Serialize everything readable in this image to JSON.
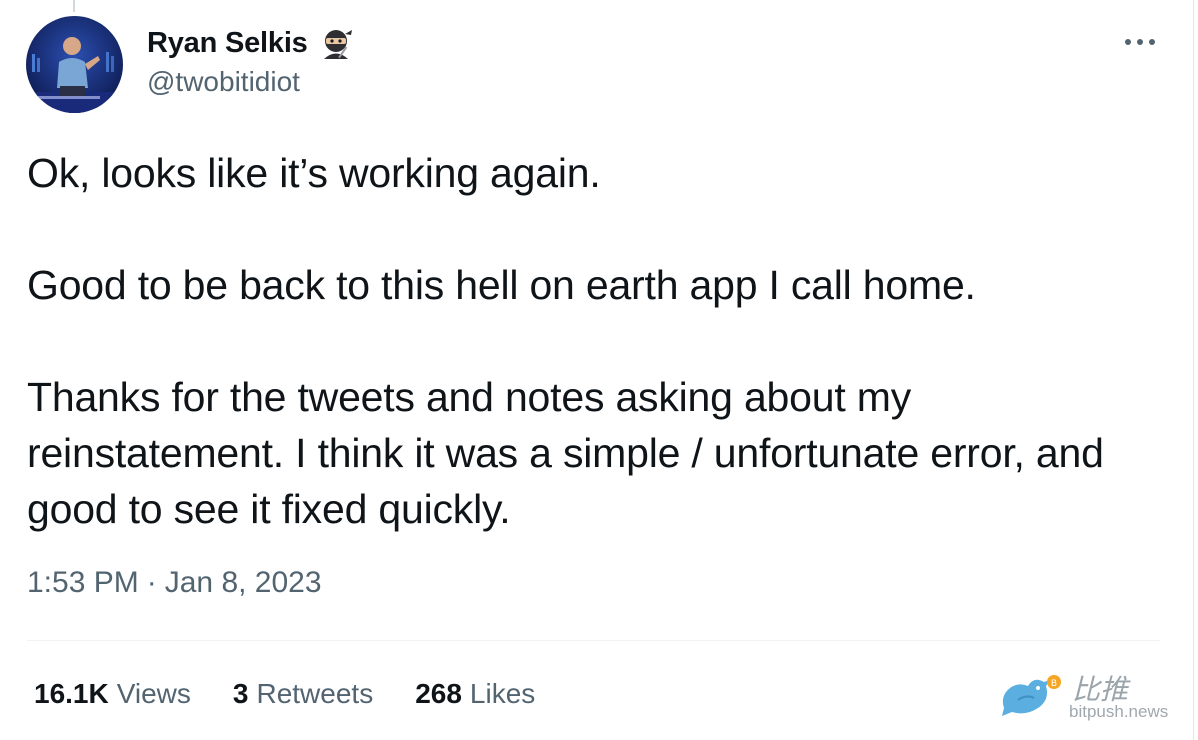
{
  "author": {
    "display_name": "Ryan Selkis",
    "handle": "@twobitidiot",
    "name_emoji_icon": "ninja-icon"
  },
  "menu": {
    "more_icon": "more-horizontal-icon"
  },
  "tweet": {
    "paragraphs": [
      "Ok, looks like it’s working again.",
      "Good to be back to this hell on earth app I call home.",
      "Thanks for the tweets and notes asking about my reinstatement. I think it was a simple / unfortunate error, and good to see it fixed quickly."
    ]
  },
  "meta": {
    "time": "1:53 PM",
    "separator": "·",
    "date": "Jan 8, 2023"
  },
  "stats": {
    "views_count": "16.1K",
    "views_label": "Views",
    "retweets_count": "3",
    "retweets_label": "Retweets",
    "likes_count": "268",
    "likes_label": "Likes"
  },
  "watermark": {
    "chinese_text": "比推",
    "domain": "bitpush.news"
  },
  "colors": {
    "text_primary": "#0f1419",
    "text_secondary": "#536471",
    "divider": "#eff3f4",
    "watermark_bird": "#5aaee0",
    "watermark_coin": "#f5a623"
  }
}
